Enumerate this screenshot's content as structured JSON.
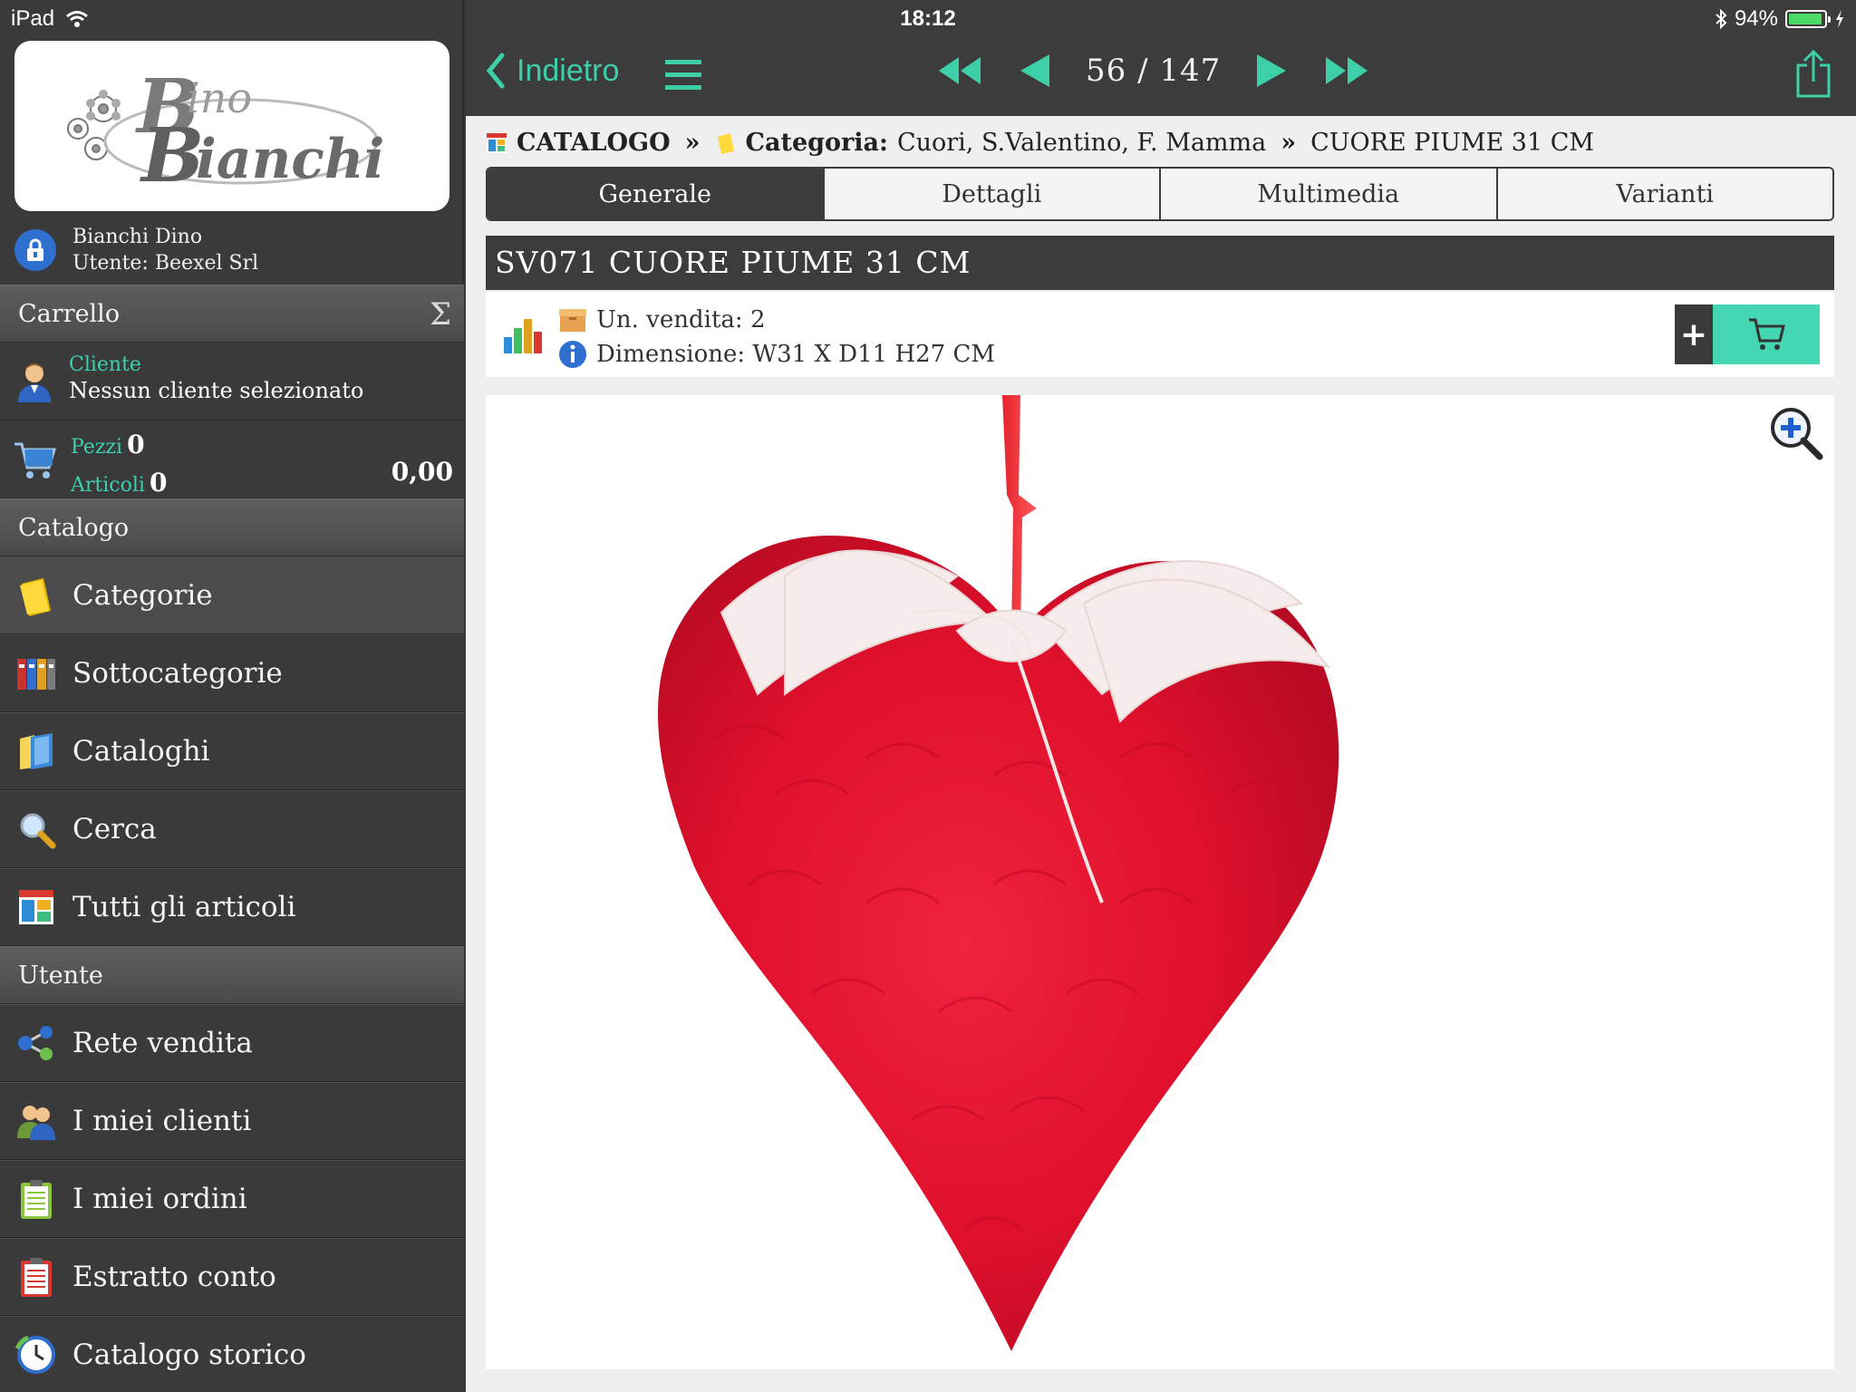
{
  "status_bar": {
    "device": "iPad",
    "time": "18:12",
    "battery": "94%",
    "battery_level": 0.94
  },
  "sidebar": {
    "logo_text": "Bino Bianchi",
    "user": {
      "name": "Bianchi Dino",
      "account": "Utente: Beexel Srl"
    },
    "cart_header": "Carrello",
    "cart": {
      "client_label": "Cliente",
      "client_value": "Nessun cliente selezionato",
      "pieces_label": "Pezzi",
      "pieces_value": "0",
      "articles_label": "Articoli",
      "articles_value": "0",
      "total": "0,00"
    },
    "catalog_header": "Catalogo",
    "catalog_items": [
      {
        "label": "Categorie",
        "icon": "folder-icon"
      },
      {
        "label": "Sottocategorie",
        "icon": "binders-icon"
      },
      {
        "label": "Cataloghi",
        "icon": "book-icon"
      },
      {
        "label": "Cerca",
        "icon": "search-icon"
      },
      {
        "label": "Tutti gli articoli",
        "icon": "grid-icon"
      }
    ],
    "user_header": "Utente",
    "user_items": [
      {
        "label": "Rete vendita",
        "icon": "network-icon"
      },
      {
        "label": "I miei clienti",
        "icon": "clients-icon"
      },
      {
        "label": "I miei ordini",
        "icon": "orders-icon"
      },
      {
        "label": "Estratto conto",
        "icon": "statement-icon"
      },
      {
        "label": "Catalogo storico",
        "icon": "history-icon"
      }
    ]
  },
  "navbar": {
    "back_label": "Indietro",
    "pager": "56 / 147"
  },
  "breadcrumb": {
    "root": "CATALOGO",
    "sep": "»",
    "category_label": "Categoria:",
    "category_value": "Cuori, S.Valentino, F. Mamma",
    "current": "CUORE PIUME 31 CM"
  },
  "tabs": [
    "Generale",
    "Dettagli",
    "Multimedia",
    "Varianti"
  ],
  "product": {
    "title": "SV071 CUORE PIUME 31 CM",
    "unit_sale": "Un. vendita: 2",
    "dimension": "Dimensione: W31 X D11 H27 CM",
    "add_label": "+"
  },
  "colors": {
    "accent": "#3dd0a8",
    "cart_button": "#45d6b4",
    "dark": "#3c3c3c"
  }
}
